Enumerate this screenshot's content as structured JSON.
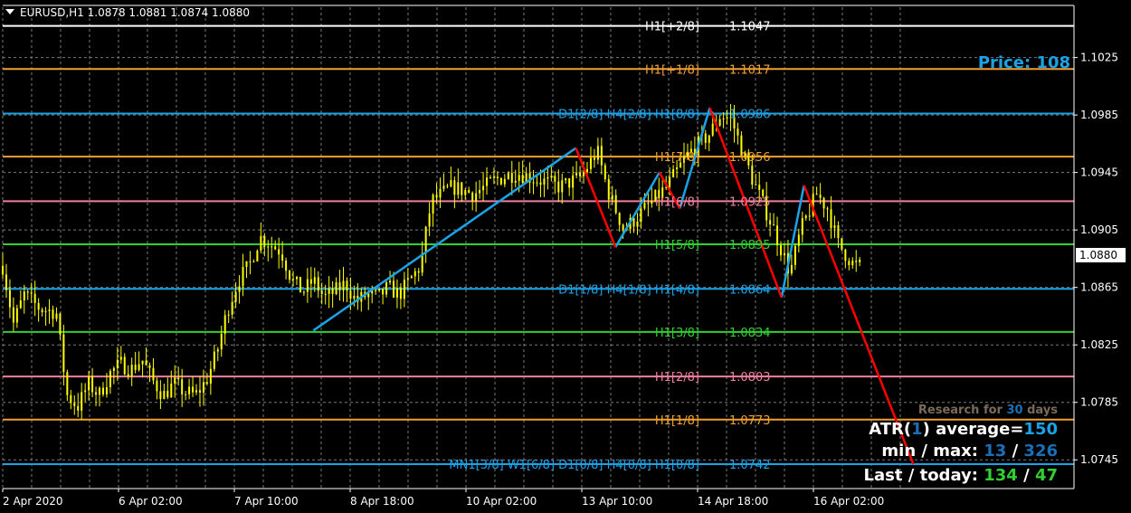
{
  "header": {
    "symbol_text": "EURUSD,H1  1.0878 1.0881 1.0874 1.0880",
    "current_price_label": "1.0880"
  },
  "colors": {
    "background": "#000000",
    "grid": "#7a7a7a",
    "candle": "#ffff00",
    "blue": "#1aa3e8",
    "orange": "#f0a030",
    "pink": "#f080a0",
    "green": "#30d030",
    "red": "#ff0000",
    "white": "#ffffff"
  },
  "chart_data": {
    "type": "line",
    "y_range": [
      1.0725,
      1.106
    ],
    "y_ticks": [
      "1.1025",
      "1.0985",
      "1.0945",
      "1.0905",
      "1.0865",
      "1.0825",
      "1.0785",
      "1.0745"
    ],
    "x_ticks": [
      "2 Apr 2020",
      "6 Apr 02:00",
      "7 Apr 10:00",
      "8 Apr 18:00",
      "10 Apr 02:00",
      "13 Apr 10:00",
      "14 Apr 18:00",
      "16 Apr 02:00"
    ],
    "grid": true,
    "levels": [
      {
        "label": "H1[+2/8]",
        "value": "1.1047",
        "price": 1.1047,
        "color": "white"
      },
      {
        "label": "H1[+1/8]",
        "value": "1.1017",
        "price": 1.1017,
        "color": "orange"
      },
      {
        "label": "D1[2/8] H4[2/8] H1[8/8]",
        "value": "1.0986",
        "price": 1.0986,
        "color": "blue"
      },
      {
        "label": "H1[7/8]",
        "value": "1.0956",
        "price": 1.0956,
        "color": "orange"
      },
      {
        "label": "H1[6/8]",
        "value": "1.0925",
        "price": 1.0925,
        "color": "pink"
      },
      {
        "label": "H1[5/8]",
        "value": "1.0895",
        "price": 1.0895,
        "color": "green"
      },
      {
        "label": "D1[1/8] H4[1/8] H1[4/8]",
        "value": "1.0864",
        "price": 1.0864,
        "color": "blue"
      },
      {
        "label": "H1[3/8]",
        "value": "1.0834",
        "price": 1.0834,
        "color": "green"
      },
      {
        "label": "H1[2/8]",
        "value": "1.0803",
        "price": 1.0803,
        "color": "pink"
      },
      {
        "label": "H1[1/8]",
        "value": "1.0773",
        "price": 1.0773,
        "color": "orange"
      },
      {
        "label": "MN1[3/8] W1[6/8] D1[0/8] H4[0/8] H1[0/8]",
        "value": "1.0742",
        "price": 1.0742,
        "color": "blue"
      }
    ],
    "price_path": [
      [
        0.0,
        1.088
      ],
      [
        0.01,
        1.084
      ],
      [
        0.02,
        1.086
      ],
      [
        0.035,
        1.085
      ],
      [
        0.05,
        1.0848
      ],
      [
        0.06,
        1.079
      ],
      [
        0.07,
        1.0782
      ],
      [
        0.08,
        1.0798
      ],
      [
        0.09,
        1.079
      ],
      [
        0.1,
        1.0805
      ],
      [
        0.11,
        1.0812
      ],
      [
        0.12,
        1.0808
      ],
      [
        0.13,
        1.0815
      ],
      [
        0.14,
        1.08
      ],
      [
        0.15,
        1.079
      ],
      [
        0.16,
        1.0798
      ],
      [
        0.17,
        1.0792
      ],
      [
        0.18,
        1.079
      ],
      [
        0.19,
        1.08
      ],
      [
        0.2,
        1.082
      ],
      [
        0.21,
        1.085
      ],
      [
        0.22,
        1.087
      ],
      [
        0.23,
        1.088
      ],
      [
        0.24,
        1.09
      ],
      [
        0.25,
        1.0895
      ],
      [
        0.26,
        1.089
      ],
      [
        0.27,
        1.087
      ],
      [
        0.28,
        1.0862
      ],
      [
        0.29,
        1.087
      ],
      [
        0.3,
        1.0858
      ],
      [
        0.31,
        1.0862
      ],
      [
        0.32,
        1.0868
      ],
      [
        0.33,
        1.0855
      ],
      [
        0.34,
        1.086
      ],
      [
        0.35,
        1.0858
      ],
      [
        0.36,
        1.0865
      ],
      [
        0.37,
        1.086
      ],
      [
        0.38,
        1.087
      ],
      [
        0.39,
        1.088
      ],
      [
        0.4,
        1.0925
      ],
      [
        0.42,
        1.0935
      ],
      [
        0.44,
        1.093
      ],
      [
        0.46,
        1.094
      ],
      [
        0.48,
        1.0945
      ],
      [
        0.5,
        1.094
      ],
      [
        0.52,
        1.0935
      ],
      [
        0.54,
        1.0942
      ],
      [
        0.555,
        1.096
      ],
      [
        0.565,
        1.0932
      ],
      [
        0.58,
        1.0905
      ],
      [
        0.6,
        1.092
      ],
      [
        0.62,
        1.0935
      ],
      [
        0.64,
        1.0958
      ],
      [
        0.66,
        1.0972
      ],
      [
        0.67,
        1.0985
      ],
      [
        0.68,
        1.0982
      ],
      [
        0.7,
        1.094
      ],
      [
        0.72,
        1.0905
      ],
      [
        0.735,
        1.0875
      ],
      [
        0.745,
        1.0905
      ],
      [
        0.76,
        1.093
      ],
      [
        0.77,
        1.092
      ],
      [
        0.78,
        1.0895
      ],
      [
        0.795,
        1.088
      ],
      [
        0.8,
        1.088
      ]
    ],
    "zigzag_blue": [
      [
        [
          0.29,
          1.0835
        ],
        [
          0.535,
          1.0962
        ]
      ],
      [
        [
          0.572,
          1.0893
        ],
        [
          0.613,
          1.0945
        ]
      ],
      [
        [
          0.632,
          1.092
        ],
        [
          0.66,
          1.099
        ]
      ],
      [
        [
          0.727,
          1.0858
        ],
        [
          0.748,
          1.0936
        ]
      ]
    ],
    "zigzag_red": [
      [
        [
          0.535,
          1.0962
        ],
        [
          0.572,
          1.0893
        ]
      ],
      [
        [
          0.613,
          1.0945
        ],
        [
          0.632,
          1.092
        ]
      ],
      [
        [
          0.66,
          1.099
        ],
        [
          0.727,
          1.0858
        ]
      ],
      [
        [
          0.748,
          1.0936
        ],
        [
          0.85,
          1.0742
        ]
      ]
    ]
  },
  "info_panel": {
    "price_label": "Price: 108",
    "research_prefix": "Research for ",
    "research_days": "30",
    "research_suffix": " days",
    "atr_prefix": "ATR(",
    "atr_period": "1",
    "atr_mid": ") average=",
    "atr_value": "150",
    "minmax_label": "min / max: ",
    "min_value": "13",
    "minmax_sep": " / ",
    "max_value": "326",
    "last_label": "Last / today: ",
    "last_value": "134",
    "last_sep": " / ",
    "today_value": "47"
  }
}
